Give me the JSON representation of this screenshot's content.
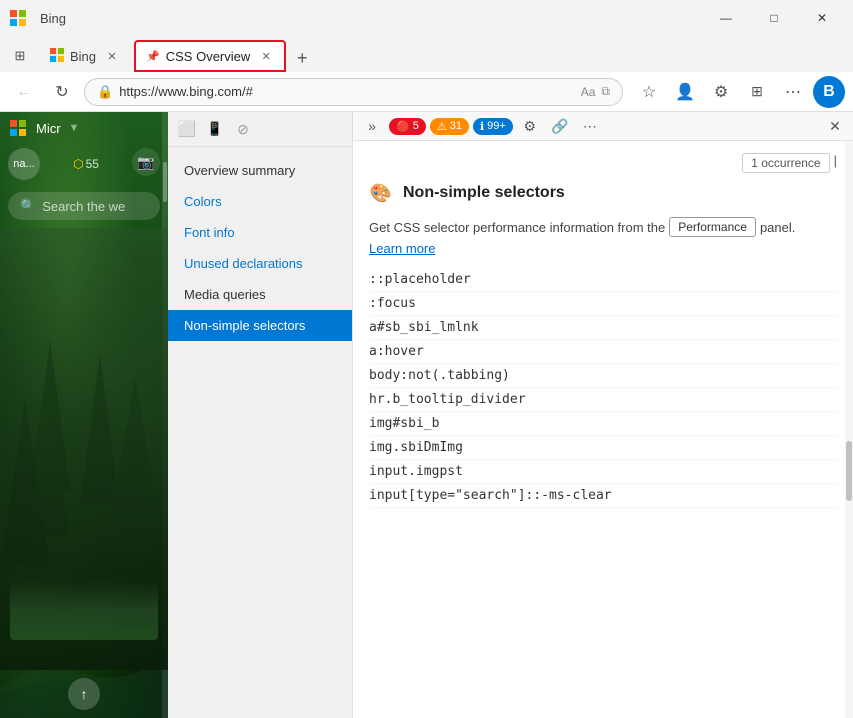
{
  "window": {
    "title": "Bing",
    "minimize_label": "—",
    "maximize_label": "□",
    "close_label": "✕"
  },
  "tabs": [
    {
      "label": "Bing",
      "favicon": "🌐",
      "active": false,
      "closable": true
    },
    {
      "label": "CSS Overview",
      "favicon": "🔧",
      "active": true,
      "closable": true,
      "has_pin": true
    }
  ],
  "tab_add_label": "+",
  "address_bar": {
    "url": "https://www.bing.com/#",
    "lock_icon": "🔒"
  },
  "devtools": {
    "topbar": {
      "error_count": "5",
      "warn_count": "31",
      "info_count": "99+",
      "more_label": "⋯",
      "close_label": "✕",
      "overflow_label": "»"
    },
    "sidebar": {
      "items": [
        {
          "label": "Overview summary",
          "active": false
        },
        {
          "label": "Colors",
          "active": false,
          "colored": true
        },
        {
          "label": "Font info",
          "active": false,
          "colored": true
        },
        {
          "label": "Unused declarations",
          "active": false,
          "colored": true
        },
        {
          "label": "Media queries",
          "active": false
        },
        {
          "label": "Non-simple selectors",
          "active": true
        }
      ]
    },
    "main": {
      "occurrence_text": "1 occurrence",
      "section": {
        "icon": "🎨",
        "title": "Non-simple selectors"
      },
      "info_text_before": "Get CSS selector performance information from the",
      "performance_btn": "Performance",
      "info_text_after": "panel.",
      "learn_more": "Learn more",
      "selectors": [
        "::placeholder",
        ":focus",
        "a#sb_sbi_lmlnk",
        "a:hover",
        "body:not(.tabbing)",
        "hr.b_tooltip_divider",
        "img#sbi_b",
        "img.sbiDmImg",
        "input.imgpst",
        "input[type=\"search\"]::-ms-clear"
      ]
    }
  },
  "bing": {
    "logo_text": "Micr",
    "avatar_label": "na...",
    "count": "55",
    "search_placeholder": "Search the we",
    "scroll_up_label": "↑"
  },
  "toolbar": {
    "back_label": "←",
    "refresh_label": "↻",
    "read_aloud_label": "Aa",
    "favorites_label": "☆",
    "profile_label": "👤",
    "settings_label": "⚙",
    "bing_label": "B",
    "tab_actions_label": "⊞",
    "more_label": "⋯"
  }
}
